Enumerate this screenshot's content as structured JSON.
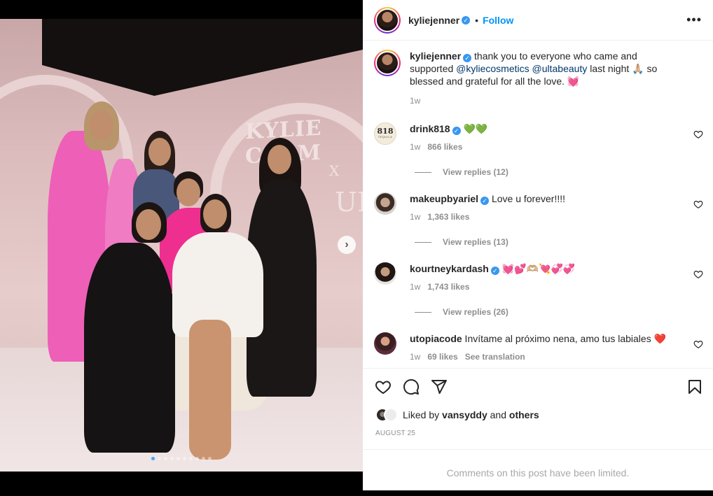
{
  "post": {
    "author": "kyliejenner",
    "follow_label": "Follow",
    "separator": "•",
    "more_label": "•••",
    "photo": {
      "wall_text_line1": "KYLIE COSM",
      "wall_text_line2": "X",
      "wall_text_line3": "ULTA",
      "carousel_count": 10,
      "carousel_active_index": 0
    },
    "caption": {
      "username": "kyliejenner",
      "text_before": " thank you to everyone who came and supported ",
      "mention_1": "@kyliecosmetics",
      "text_between": " ",
      "mention_2": "@ultabeauty",
      "text_after": " last night 🙏🏼 so blessed and grateful for all the love. ",
      "emoji_end": "💓",
      "time": "1w"
    },
    "comments": [
      {
        "username": "drink818",
        "text": " 💚💚",
        "time": "1w",
        "likes": "866 likes",
        "view_replies": "View replies (12)",
        "avatar_text": "818",
        "avatar_subtext": "TEQUILA"
      },
      {
        "username": "makeupbyariel",
        "text": " Love u forever!!!!",
        "time": "1w",
        "likes": "1,363 likes",
        "view_replies": "View replies (13)"
      },
      {
        "username": "kourtneykardash",
        "text": " 💓💕🫶🏼💘💞💞",
        "time": "1w",
        "likes": "1,743 likes",
        "view_replies": "View replies (26)"
      },
      {
        "username": "utopiacode",
        "text": " Invítame al próximo nena, amo tus labiales ❤️",
        "time": "1w",
        "likes": "69 likes",
        "see_translation": "See translation"
      }
    ],
    "liked_by": {
      "prefix": "Liked by ",
      "user": "vansyddy",
      "middle": " and ",
      "others": "others"
    },
    "date": "AUGUST 25",
    "comments_limited": "Comments on this post have been limited."
  },
  "colors": {
    "accent": "#0095f6",
    "verified": "#3897f0",
    "muted": "#8e8e8e",
    "mention": "#00376b"
  },
  "icons": {
    "like": "heart-icon",
    "comment": "comment-icon",
    "share": "share-icon",
    "save": "bookmark-icon",
    "next": "chevron-right-icon"
  }
}
